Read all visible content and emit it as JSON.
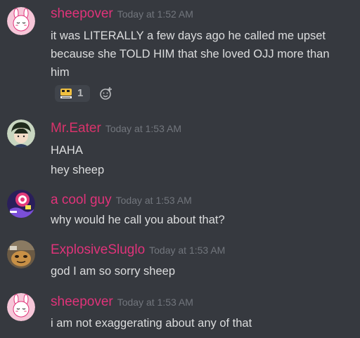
{
  "messages": [
    {
      "username": "sheepover",
      "username_color": "#e0337a",
      "timestamp": "Today at 1:52 AM",
      "lines": [
        "it was LITERALLY a few days ago he called me upset",
        "because she TOLD HIM that she loved OJJ more than",
        "him"
      ],
      "reaction": {
        "icon": "custom-emoji-icon",
        "count": "1"
      }
    },
    {
      "username": "Mr.Eater",
      "username_color": "#d9336b",
      "timestamp": "Today at 1:53 AM",
      "lines": [
        "HAHA",
        "hey sheep"
      ]
    },
    {
      "username": "a cool guy",
      "username_color": "#e0337a",
      "timestamp": "Today at 1:53 AM",
      "lines": [
        "why would he call you about that?"
      ]
    },
    {
      "username": "ExplosiveSluglo",
      "username_color": "#e0337a",
      "timestamp": "Today at 1:53 AM",
      "lines": [
        "god I am so sorry sheep"
      ]
    },
    {
      "username": "sheepover",
      "username_color": "#e0337a",
      "timestamp": "Today at 1:53 AM",
      "lines": [
        "i am not exaggerating about any of that"
      ]
    }
  ],
  "colors": {
    "background": "#36393f",
    "text": "#dcddde",
    "timestamp": "#72767d"
  }
}
